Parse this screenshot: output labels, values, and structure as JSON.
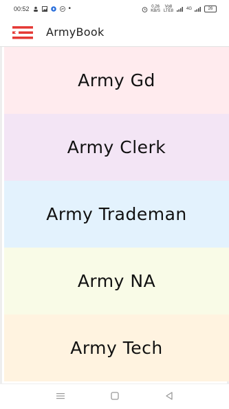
{
  "status_bar": {
    "time": "00:52",
    "speed": "0.26",
    "speed_unit": "KB/S",
    "network": "Vo8 LTE8",
    "network2": "4G",
    "battery": "26"
  },
  "app_bar": {
    "title": "ArmyBook",
    "menu_icon": "menu-icon",
    "accent": "#e53935"
  },
  "categories": [
    {
      "label": "Army Gd",
      "color": "#ffebee"
    },
    {
      "label": "Army Clerk",
      "color": "#f3e5f5"
    },
    {
      "label": "Army Trademan",
      "color": "#e3f2fd"
    },
    {
      "label": "Army NA",
      "color": "#f9fbe7"
    },
    {
      "label": "Army Tech",
      "color": "#fff3e0"
    }
  ],
  "nav": {
    "menu": "menu-icon",
    "home": "home-icon",
    "back": "back-icon"
  }
}
